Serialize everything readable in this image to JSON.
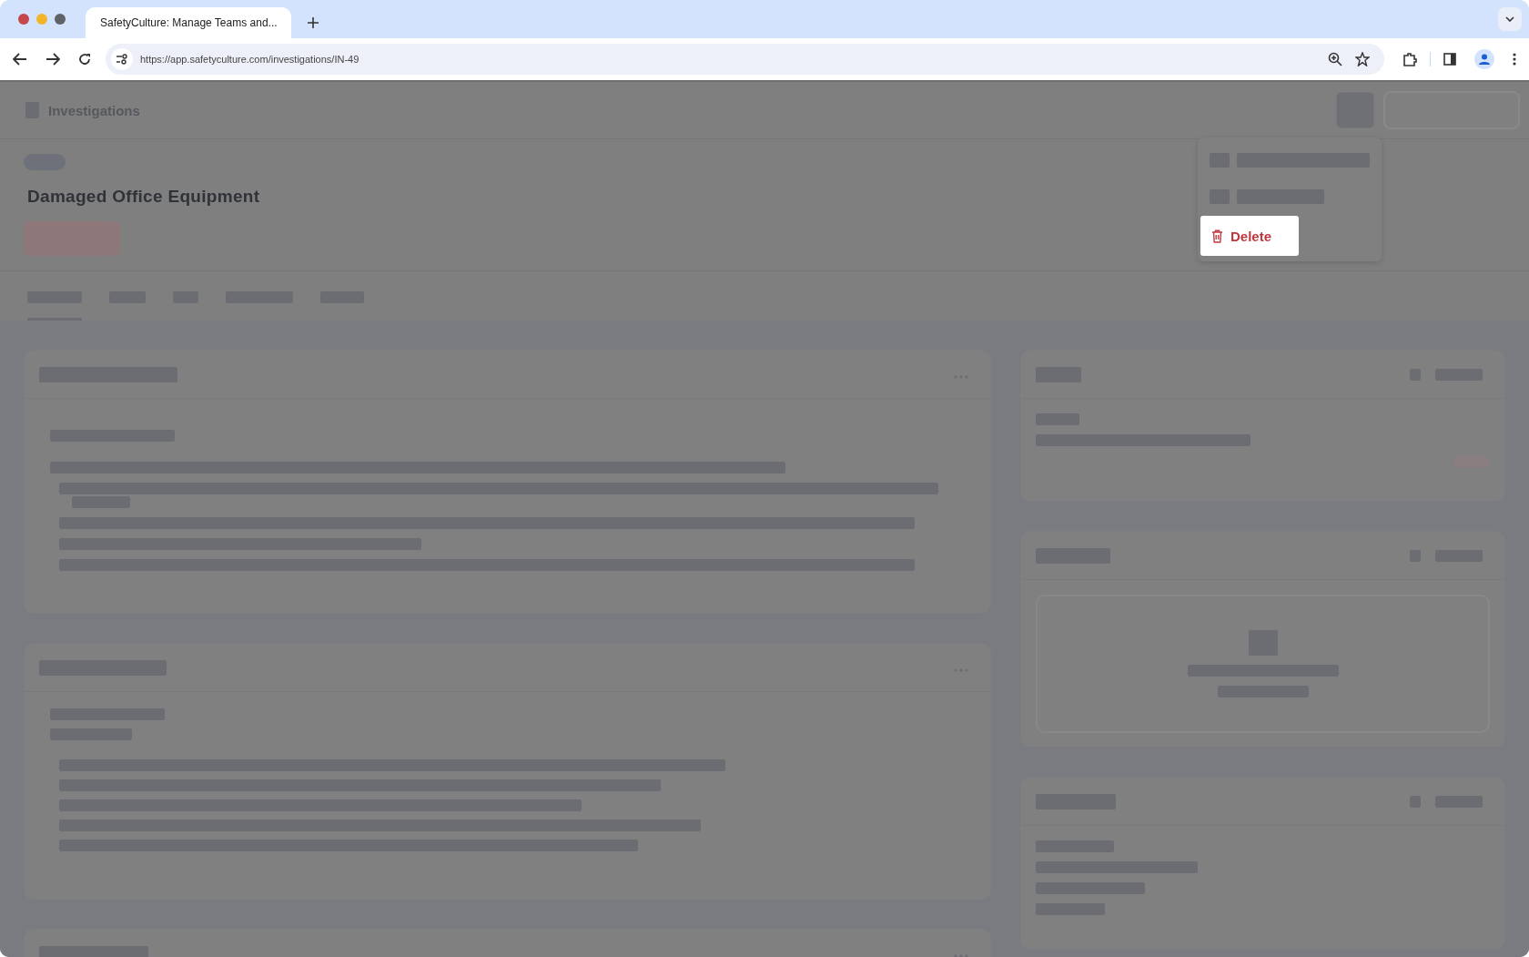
{
  "browser": {
    "tab_title": "SafetyCulture: Manage Teams and...",
    "url": "https://app.safetyculture.com/investigations/IN-49"
  },
  "page": {
    "breadcrumb": "Investigations",
    "title": "Damaged Office Equipment"
  },
  "tabs": [
    {
      "selected": true
    },
    {
      "selected": false
    },
    {
      "selected": false
    },
    {
      "selected": false
    },
    {
      "selected": false
    }
  ],
  "menu": [
    {
      "kind": "blurred",
      "selected": false
    },
    {
      "kind": "blurred",
      "selected": false
    },
    {
      "kind": "action",
      "label": "Delete",
      "selected": true
    }
  ]
}
